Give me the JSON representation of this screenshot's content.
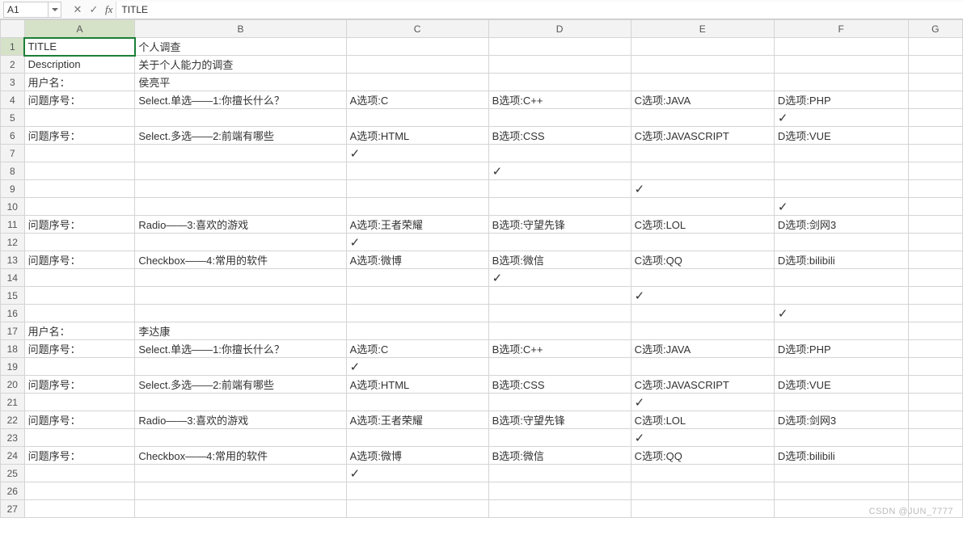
{
  "formula_bar": {
    "name_box": "A1",
    "cancel_icon": "✕",
    "confirm_icon": "✓",
    "fx_label": "fx",
    "content": "TITLE"
  },
  "columns": [
    "A",
    "B",
    "C",
    "D",
    "E",
    "F",
    "G"
  ],
  "check": "✓",
  "rows": [
    {
      "n": "1",
      "A": "TITLE",
      "B": "个人调查"
    },
    {
      "n": "2",
      "A": "Description",
      "B": "关于个人能力的调查"
    },
    {
      "n": "3",
      "A": "用户名：",
      "B": "侯亮平"
    },
    {
      "n": "4",
      "A": "问题序号：",
      "B": "Select.单选——1:你擅长什么？",
      "C": "A选项:C",
      "D": "B选项:C++",
      "E": "C选项:JAVA",
      "F": "D选项:PHP"
    },
    {
      "n": "5",
      "F": "✓"
    },
    {
      "n": "6",
      "A": "问题序号：",
      "B": "Select.多选——2:前端有哪些",
      "C": "A选项:HTML",
      "D": "B选项:CSS",
      "E": "C选项:JAVASCRIPT",
      "F": "D选项:VUE"
    },
    {
      "n": "7",
      "C": "✓"
    },
    {
      "n": "8",
      "D": "✓"
    },
    {
      "n": "9",
      "E": "✓"
    },
    {
      "n": "10",
      "F": "✓"
    },
    {
      "n": "11",
      "A": "问题序号：",
      "B": "Radio——3:喜欢的游戏",
      "C": "A选项:王者荣耀",
      "D": "B选项:守望先锋",
      "E": "C选项:LOL",
      "F": "D选项:剑网3"
    },
    {
      "n": "12",
      "C": "✓"
    },
    {
      "n": "13",
      "A": "问题序号：",
      "B": "Checkbox——4:常用的软件",
      "C": "A选项:微博",
      "D": "B选项:微信",
      "E": "C选项:QQ",
      "F": "D选项:bilibili"
    },
    {
      "n": "14",
      "D": "✓"
    },
    {
      "n": "15",
      "E": "✓"
    },
    {
      "n": "16",
      "F": "✓"
    },
    {
      "n": "17",
      "A": "用户名：",
      "B": "李达康"
    },
    {
      "n": "18",
      "A": "问题序号：",
      "B": "Select.单选——1:你擅长什么？",
      "C": "A选项:C",
      "D": "B选项:C++",
      "E": "C选项:JAVA",
      "F": "D选项:PHP"
    },
    {
      "n": "19",
      "C": "✓"
    },
    {
      "n": "20",
      "A": "问题序号：",
      "B": "Select.多选——2:前端有哪些",
      "C": "A选项:HTML",
      "D": "B选项:CSS",
      "E": "C选项:JAVASCRIPT",
      "F": "D选项:VUE"
    },
    {
      "n": "21",
      "E": "✓"
    },
    {
      "n": "22",
      "A": "问题序号：",
      "B": "Radio——3:喜欢的游戏",
      "C": "A选项:王者荣耀",
      "D": "B选项:守望先锋",
      "E": "C选项:LOL",
      "F": "D选项:剑网3"
    },
    {
      "n": "23",
      "E": "✓"
    },
    {
      "n": "24",
      "A": "问题序号：",
      "B": "Checkbox——4:常用的软件",
      "C": "A选项:微博",
      "D": "B选项:微信",
      "E": "C选项:QQ",
      "F": "D选项:bilibili"
    },
    {
      "n": "25",
      "C": "✓"
    },
    {
      "n": "26"
    },
    {
      "n": "27"
    }
  ],
  "selected_cell_row": "1",
  "selected_cell_col": "A",
  "watermark": "CSDN @JUN_7777"
}
